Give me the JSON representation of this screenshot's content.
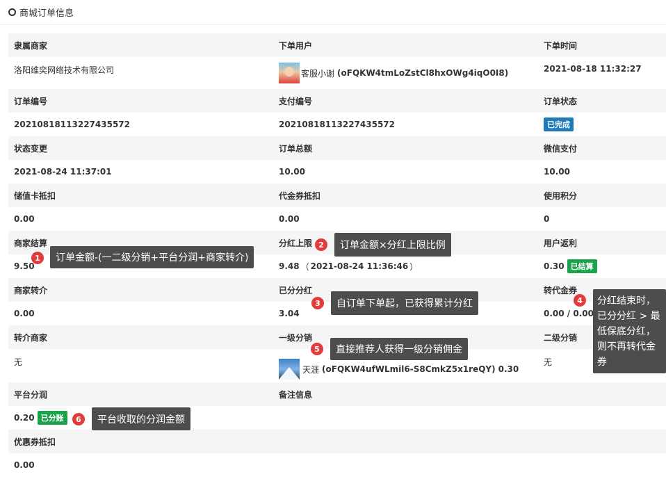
{
  "header": {
    "title": "商城订单信息",
    "icon": "circle-icon"
  },
  "rows": {
    "r1_labels": [
      "隶属商家",
      "下单用户",
      "下单时间"
    ],
    "r1_values": {
      "merchant": "洛阳维奕网络技术有限公司",
      "user_name": "客服小谢",
      "user_id": "(oFQKW4tmLoZstCl8hxOWg4iqO0I8)",
      "time": "2021-08-18 11:32:27"
    },
    "r2_labels": [
      "订单编号",
      "支付编号",
      "订单状态"
    ],
    "r2_values": {
      "order_no": "20210818113227435572",
      "pay_no": "20210818113227435572",
      "status": "已完成"
    },
    "r3_labels": [
      "状态变更",
      "订单总额",
      "微信支付"
    ],
    "r3_values": {
      "changed": "2021-08-24 11:37:01",
      "total": "10.00",
      "wechat": "10.00"
    },
    "r4_labels": [
      "储值卡抵扣",
      "代金券抵扣",
      "使用积分"
    ],
    "r4_values": {
      "card": "0.00",
      "voucher": "0.00",
      "points": "0"
    },
    "r5_labels": [
      "商家结算",
      "分红上限",
      "用户返利"
    ],
    "r5_values": {
      "settle": "9.50",
      "cap": "9.48",
      "cap_open": "（",
      "cap_time": "2021-08-24 11:36:46",
      "cap_close": "）",
      "rebate": "0.30",
      "rebate_badge": "已结算"
    },
    "r6_labels": [
      "商家转介",
      "已分分红",
      "转代金券"
    ],
    "r6_values": {
      "referral": "0.00",
      "bonus": "3.04",
      "convert": "0.00 / 0.00"
    },
    "r7_labels": [
      "转介商家",
      "一级分销",
      "二级分销"
    ],
    "r7_values": {
      "ref_merchant": "无",
      "l1_name": "天涯",
      "l1_id": "(oFQKW4ufWLmil6-S8CmkZ5x1reQY)",
      "l1_amount": "0.30",
      "l2": "无"
    },
    "r8_labels": [
      "平台分润",
      "备注信息"
    ],
    "r8_values": {
      "platform": "0.20",
      "platform_badge": "已分账"
    },
    "r9_labels": [
      "优惠券抵扣"
    ],
    "r9_values": {
      "coupon": "0.00"
    }
  },
  "tips": [
    {
      "num": "1",
      "text": "订单金额-(一二级分销+平台分润+商家转介)"
    },
    {
      "num": "2",
      "text": "订单金额×分红上限比例"
    },
    {
      "num": "3",
      "text": "自订单下单起，已获得累计分红"
    },
    {
      "num": "4",
      "text": "分红结束时，已分分红 > 最低保底分红，则不再转代金券"
    },
    {
      "num": "5",
      "text": "直接推荐人获得一级分销佣金"
    },
    {
      "num": "6",
      "text": "平台收取的分润金额"
    }
  ],
  "colors": {
    "badge_blue": "#1e7ab8",
    "badge_green": "#1aa34a",
    "tip_bg": "#4d4d4d",
    "num_red": "#e23b3b",
    "label_bg": "#f5f5f5"
  }
}
